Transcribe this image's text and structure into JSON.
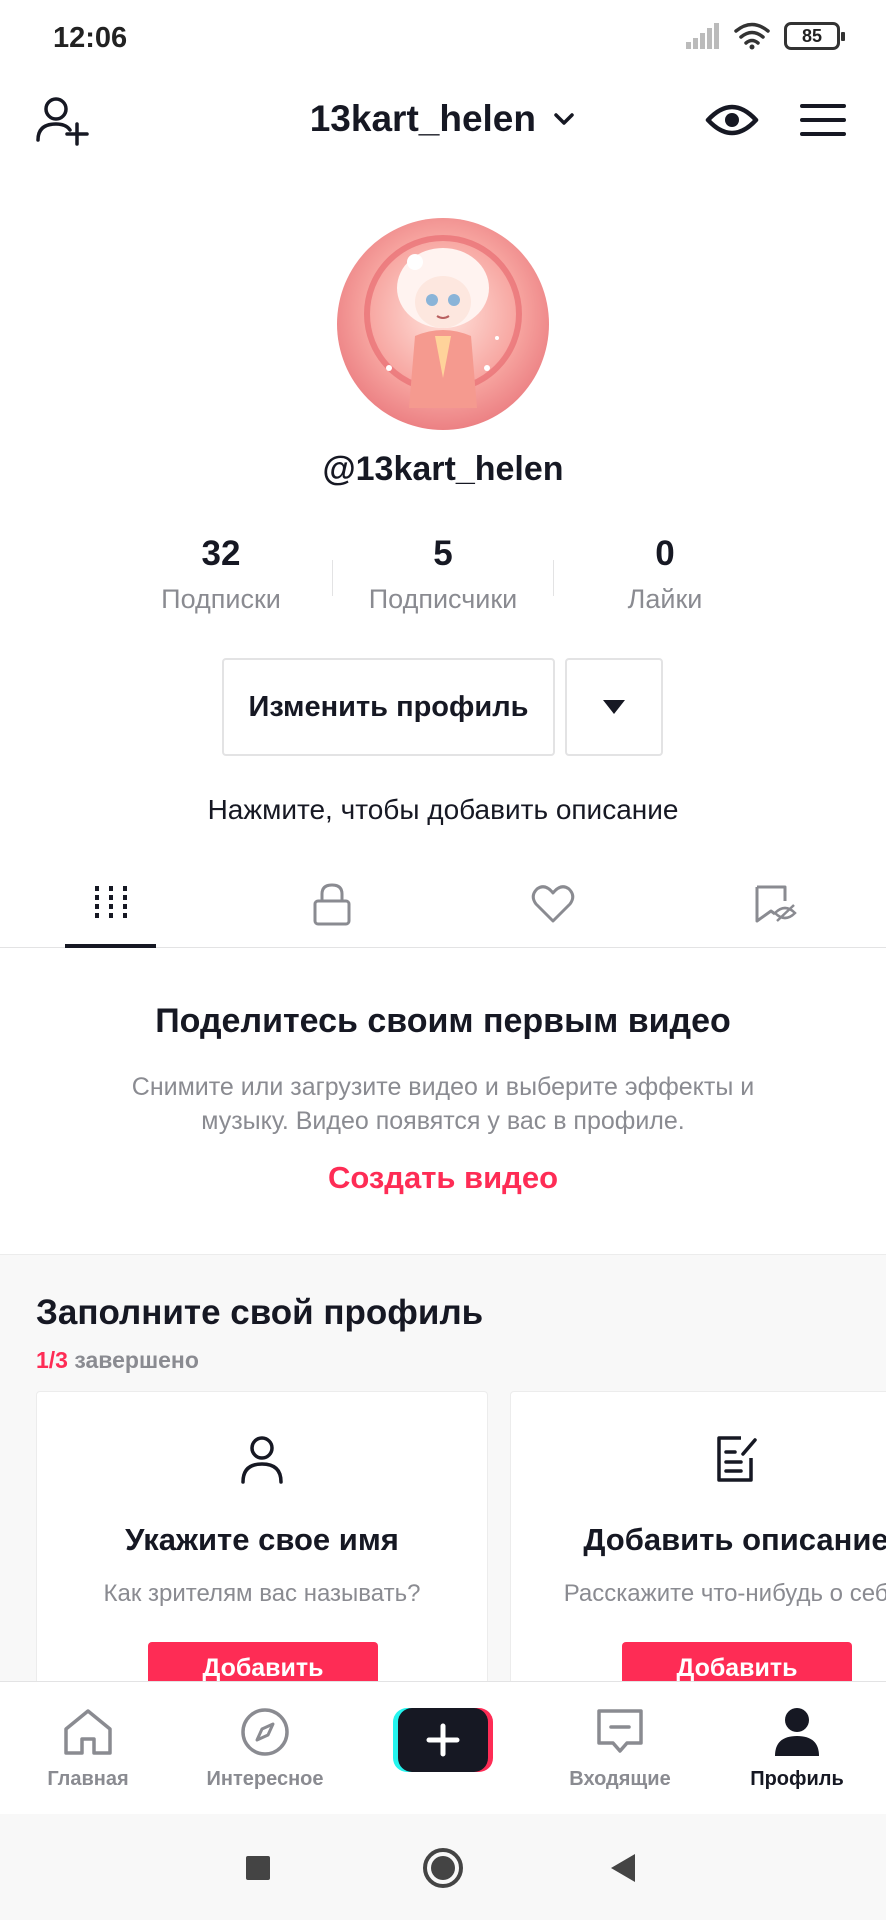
{
  "status_bar": {
    "time": "12:06",
    "battery": "85"
  },
  "header": {
    "username": "13kart_helen"
  },
  "profile": {
    "handle": "@13kart_helen"
  },
  "stats": [
    {
      "value": "32",
      "label": "Подписки"
    },
    {
      "value": "5",
      "label": "Подписчики"
    },
    {
      "value": "0",
      "label": "Лайки"
    }
  ],
  "buttons": {
    "edit_profile": "Изменить профиль"
  },
  "bio_prompt": "Нажмите, чтобы добавить описание",
  "tabs": [
    {
      "icon": "grid-icon",
      "active": true
    },
    {
      "icon": "lock-icon",
      "active": false
    },
    {
      "icon": "heart-icon",
      "active": false
    },
    {
      "icon": "hidden-bookmark-icon",
      "active": false
    }
  ],
  "empty_state": {
    "title": "Поделитесь своим первым видео",
    "description": "Снимите или загрузите видео и выберите эффекты и музыку. Видео появятся у вас в профиле.",
    "action": "Создать видео"
  },
  "complete_profile": {
    "title": "Заполните свой профиль",
    "progress": "1/3",
    "progress_suffix": "завершено",
    "cards": [
      {
        "icon": "person-icon",
        "title": "Укажите свое имя",
        "subtitle": "Как зрителям вас называть?",
        "button": "Добавить"
      },
      {
        "icon": "edit-note-icon",
        "title": "Добавить описание",
        "subtitle": "Расскажите что-нибудь о себе.",
        "button": "Добавить"
      }
    ]
  },
  "bottom_nav": [
    {
      "label": "Главная",
      "icon": "home-icon",
      "active": false
    },
    {
      "label": "Интересное",
      "icon": "compass-icon",
      "active": false
    },
    {
      "label": "",
      "icon": "create-plus-icon",
      "active": false
    },
    {
      "label": "Входящие",
      "icon": "inbox-icon",
      "active": false
    },
    {
      "label": "Профиль",
      "icon": "profile-icon",
      "active": true
    }
  ],
  "colors": {
    "accent": "#fe2c55",
    "text": "#161823",
    "muted": "#8a8b91",
    "cyan": "#25f4ee"
  }
}
